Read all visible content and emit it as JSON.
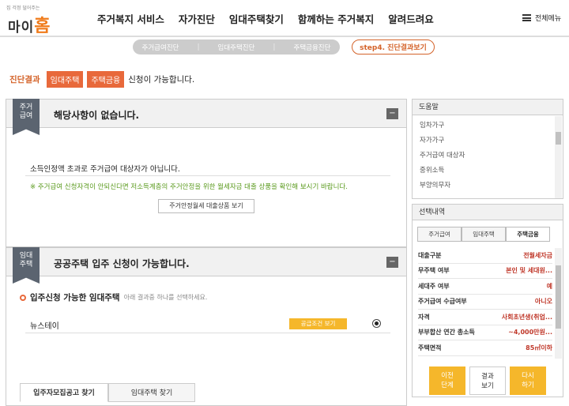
{
  "header": {
    "logo_tagline": "집 걱정 덜어주는",
    "logo_text_1": "마이",
    "logo_text_2": "홈",
    "nav": [
      "주거복지 서비스",
      "자가진단",
      "임대주택찾기",
      "함께하는 주거복지",
      "알려드려요"
    ],
    "all_menu": "전체메뉴"
  },
  "steps": {
    "items": [
      "주거급여진단",
      "임대주택진단",
      "주택금융진단"
    ],
    "separator": "|",
    "current": "step4. 진단결과보기"
  },
  "result": {
    "label": "진단결과",
    "badges": [
      "임대주택",
      "주택금융"
    ],
    "suffix": "신청이 가능합니다."
  },
  "section1": {
    "flag": "주거\n급여",
    "title": "해당사항이 없습니다.",
    "collapse": "−",
    "message": "소득인정액 초과로 주거급여 대상자가 아닙니다.",
    "note": "※ 주거급여 신청자격이 안되신다면 저소득계층의 주거안정을 위한 월세자금 대출 상품을 확인해 보시기 바랍니다.",
    "button": "주거안정월세 대출상품 보기"
  },
  "section2": {
    "flag": "임대\n주택",
    "title": "공공주택 입주 신청이 가능합니다.",
    "collapse": "−",
    "available_label": "입주신청 가능한 임대주택",
    "available_hint": "아래 결과중 하나를 선택하세요.",
    "row_name": "뉴스테이",
    "row_button": "공급조건 보기",
    "tabs": [
      "입주자모집공고 찾기",
      "임대주택 찾기"
    ]
  },
  "help": {
    "title": "도움말",
    "items": [
      "임차가구",
      "자가가구",
      "주거급여 대상자",
      "중위소득",
      "부양의무자"
    ]
  },
  "selection": {
    "title": "선택내역",
    "tabs": [
      "주거급여",
      "임대주택",
      "주택금융"
    ],
    "active_tab": "주택금융",
    "rows": [
      {
        "k": "대출구분",
        "v": "전월세자금"
      },
      {
        "k": "무주택 여부",
        "v": "본인 및 세대원..."
      },
      {
        "k": "세대주 여부",
        "v": "예"
      },
      {
        "k": "주거급여 수급여부",
        "v": "아니오"
      },
      {
        "k": "자격",
        "v": "사회초년생(취업..."
      },
      {
        "k": "부부합산 연간 총소득",
        "v": "~4,000만원..."
      },
      {
        "k": "주택면적",
        "v": "85㎡이하"
      }
    ],
    "buttons": [
      "이전\n단계",
      "결과\n보기",
      "다시\n하기"
    ]
  }
}
